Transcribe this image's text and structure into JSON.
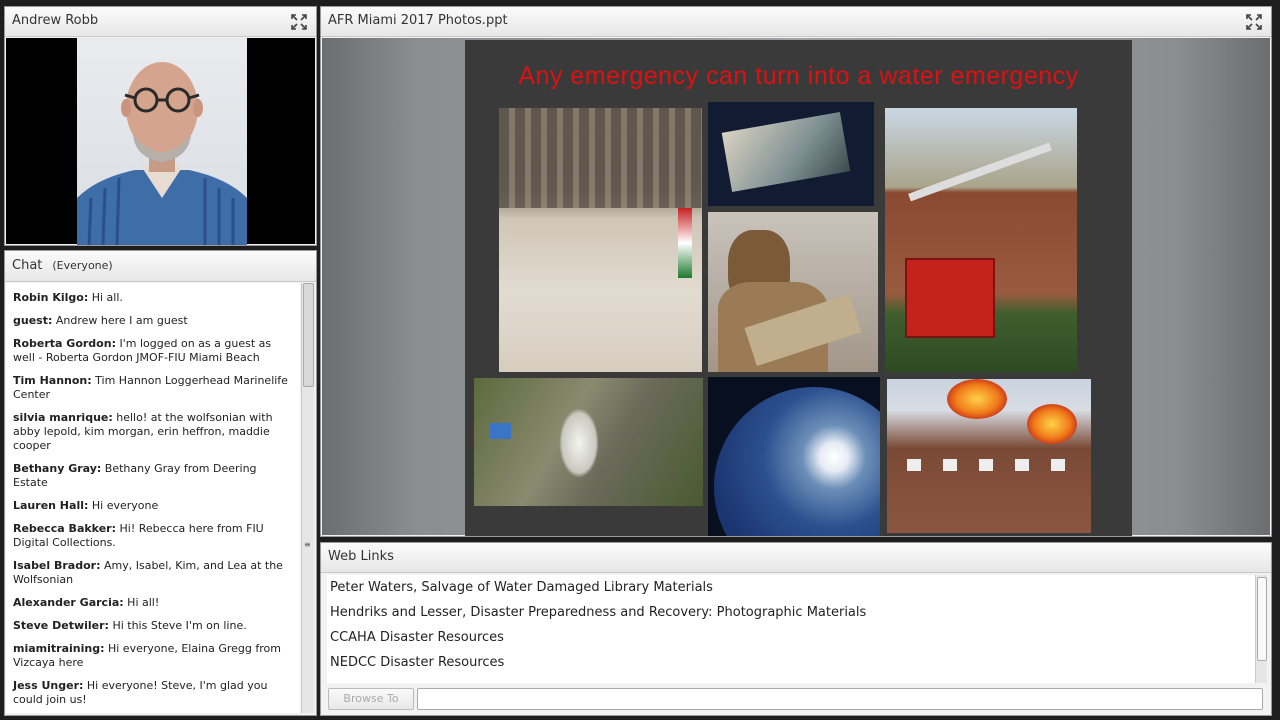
{
  "camera": {
    "title": "Andrew Robb"
  },
  "chat": {
    "title": "Chat",
    "audience": "(Everyone)",
    "messages": [
      {
        "name": "Robin Kilgo:",
        "text": "Hi all."
      },
      {
        "name": "guest:",
        "text": "Andrew here I am guest"
      },
      {
        "name": "Roberta Gordon:",
        "text": "I'm logged on as a guest as well - Roberta Gordon JMOF-FIU Miami Beach"
      },
      {
        "name": "Tim Hannon:",
        "text": "Tim Hannon Loggerhead Marinelife Center"
      },
      {
        "name": "silvia manrique:",
        "text": "hello! at the wolfsonian with abby lepold, kim morgan, erin heffron, maddie cooper"
      },
      {
        "name": "Bethany Gray:",
        "text": "Bethany Gray from Deering Estate"
      },
      {
        "name": "Lauren Hall:",
        "text": "Hi everyone"
      },
      {
        "name": "Rebecca Bakker:",
        "text": "Hi!  Rebecca here from FIU Digital Collections."
      },
      {
        "name": "Isabel Brador:",
        "text": "Amy, Isabel, Kim, and Lea at the Wolfsonian"
      },
      {
        "name": "Alexander Garcia:",
        "text": "Hi all!"
      },
      {
        "name": "Steve Detwiler:",
        "text": "Hi this Steve I'm on line."
      },
      {
        "name": "miamitraining:",
        "text": "Hi everyone, Elaina Gregg from Vizcaya here"
      },
      {
        "name": "Jess Unger:",
        "text": "Hi everyone! Steve, I'm glad you could join us!"
      }
    ]
  },
  "share": {
    "title": "AFR Miami 2017 Photos.ppt",
    "slide_title": "Any emergency can turn into a water emergency"
  },
  "links": {
    "title": "Web Links",
    "items": [
      "Peter Waters, Salvage of Water Damaged Library Materials",
      "Hendriks and Lesser, Disaster Preparedness and Recovery: Photographic Materials",
      "CCAHA Disaster Resources",
      "NEDCC Disaster Resources"
    ],
    "browse_label": "Browse To",
    "url_value": ""
  },
  "colors": {
    "slide_title": "#e01010",
    "slide_bg": "#3a3a3a"
  }
}
